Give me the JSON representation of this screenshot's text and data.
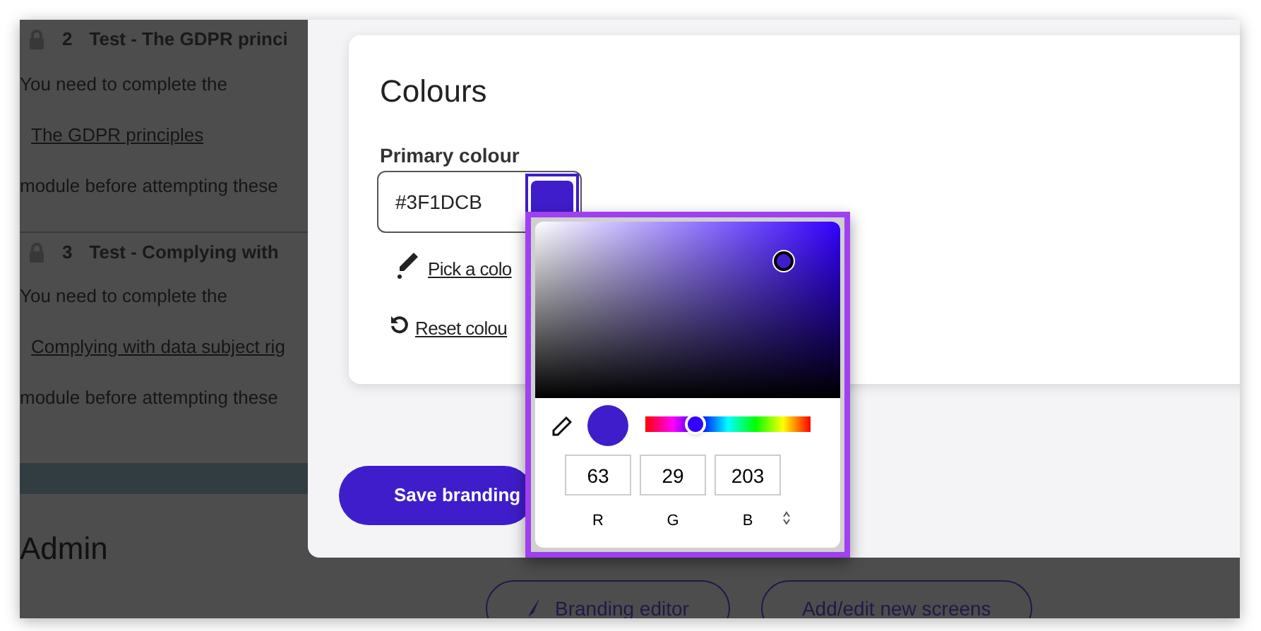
{
  "background_page": {
    "tests": [
      {
        "number": "2",
        "title": "Test - The GDPR princi",
        "intro": "You need to complete the",
        "link": "The GDPR principles",
        "outro": "module before attempting these"
      },
      {
        "number": "3",
        "title": "Test - Complying with",
        "intro": "You need to complete the",
        "link": "Complying with data subject rig",
        "outro": "module before attempting these"
      }
    ],
    "heading": "Admin",
    "buttons": [
      {
        "kind": "icon",
        "label": "Branding editor"
      },
      {
        "kind": "plain",
        "label": "Add/edit new screens"
      }
    ]
  },
  "colours_card": {
    "title": "Colours",
    "field_label": "Primary colour",
    "value": "#3F1DCB",
    "pick_link": "Pick a colo",
    "reset_link": "Reset colou"
  },
  "save_button": "Save branding",
  "color_picker": {
    "hue": {
      "level": 0.3
    },
    "channels": [
      {
        "value": "63",
        "label": "R"
      },
      {
        "value": "29",
        "label": "G"
      },
      {
        "value": "203",
        "label": "B"
      }
    ]
  }
}
